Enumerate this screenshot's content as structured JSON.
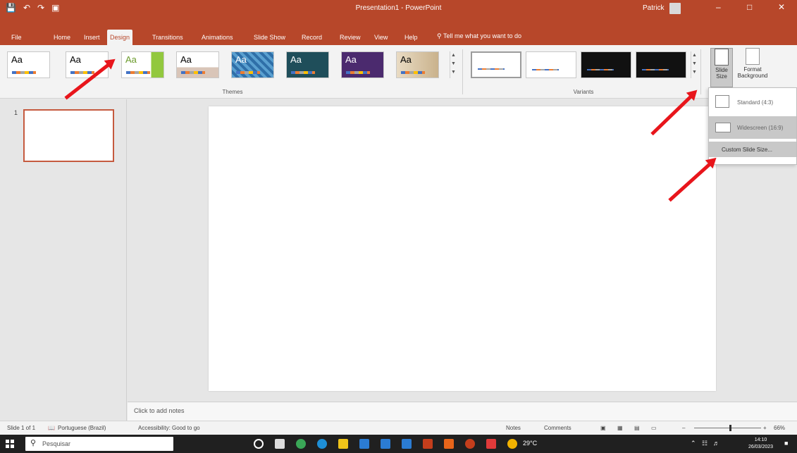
{
  "window": {
    "title": "Presentation1 - PowerPoint",
    "user": "Patrick",
    "minimize_icon": "minimize-icon",
    "maximize_icon": "maximize-icon",
    "close_icon": "close-icon"
  },
  "quick_access": {
    "save_icon": "save-icon",
    "undo_icon": "undo-icon",
    "redo_icon": "redo-icon",
    "start_icon": "present-icon"
  },
  "tabs": [
    {
      "label": "File"
    },
    {
      "label": "Home"
    },
    {
      "label": "Insert"
    },
    {
      "label": "Design",
      "active": true
    },
    {
      "label": "Transitions"
    },
    {
      "label": "Animations"
    },
    {
      "label": "Slide Show"
    },
    {
      "label": "Record"
    },
    {
      "label": "Review"
    },
    {
      "label": "View"
    },
    {
      "label": "Help"
    }
  ],
  "tell_me": "Tell me what you want to do",
  "ribbon": {
    "themes_label": "Themes",
    "variants_label": "Variants",
    "theme_sample": "Aa",
    "slide_size_label": "Slide Size",
    "format_background_label": "Format Background"
  },
  "slide_size_menu": {
    "standard": "Standard (4:3)",
    "widescreen": "Widescreen (16:9)",
    "custom": "Custom Slide Size..."
  },
  "thumbnail": {
    "number": "1"
  },
  "notes_placeholder": "Click to add notes",
  "status": {
    "slide_of": "Slide 1 of 1",
    "language": "Portuguese (Brazil)",
    "accessibility": "Accessibility: Good to go",
    "notes": "Notes",
    "comments": "Comments",
    "zoom": "66%"
  },
  "taskbar": {
    "search_placeholder": "Pesquisar",
    "weather": "29°C",
    "time": "14:10",
    "date": "26/03/2023"
  },
  "colors": {
    "accent": "#b7472a",
    "arrow": "#e8151b"
  }
}
